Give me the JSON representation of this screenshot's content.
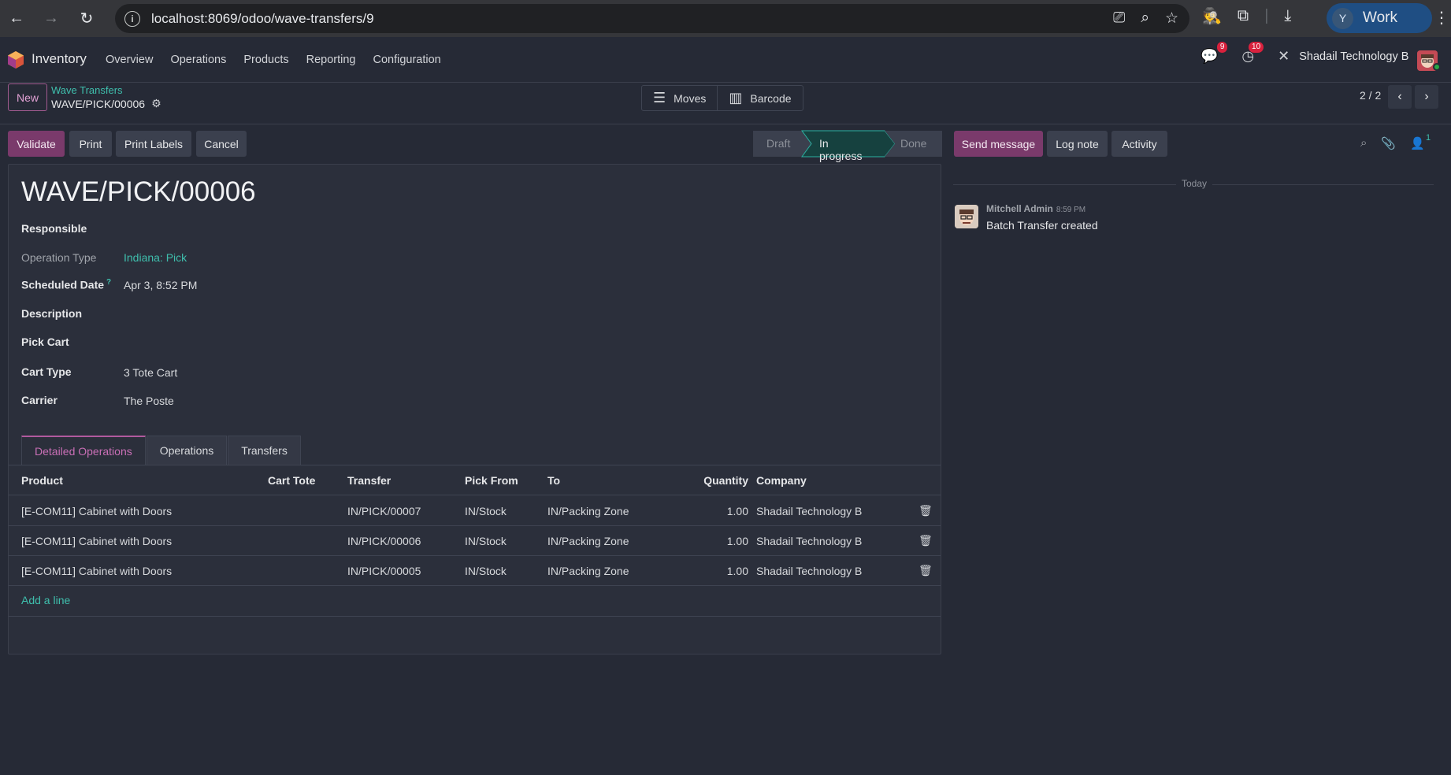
{
  "browser": {
    "url": "localhost:8069/odoo/wave-transfers/9",
    "profile_initial": "Y",
    "profile_label": "Work"
  },
  "navbar": {
    "app_name": "Inventory",
    "menu": [
      "Overview",
      "Operations",
      "Products",
      "Reporting",
      "Configuration"
    ],
    "messages_count": "9",
    "activities_count": "10",
    "company": "Shadail Technology B"
  },
  "control_panel": {
    "new_label": "New",
    "breadcrumb_parent": "Wave Transfers",
    "breadcrumb_current": "WAVE/PICK/00006",
    "smart_moves": "Moves",
    "smart_barcode": "Barcode",
    "pager": "2 / 2"
  },
  "actions": {
    "validate": "Validate",
    "print": "Print",
    "print_labels": "Print Labels",
    "cancel": "Cancel"
  },
  "status": {
    "steps": [
      "Draft",
      "In progress",
      "Done"
    ],
    "active": "In progress"
  },
  "form": {
    "title": "WAVE/PICK/00006",
    "responsible_label": "Responsible",
    "operation_type_label": "Operation Type",
    "operation_type_value": "Indiana: Pick",
    "scheduled_date_label": "Scheduled Date",
    "scheduled_date_help": "?",
    "scheduled_date_value": "Apr 3, 8:52 PM",
    "description_label": "Description",
    "pick_cart_label": "Pick Cart",
    "cart_type_label": "Cart Type",
    "cart_type_value": "3 Tote Cart",
    "carrier_label": "Carrier",
    "carrier_value": "The Poste"
  },
  "tabs": [
    "Detailed Operations",
    "Operations",
    "Transfers"
  ],
  "grid": {
    "headers": {
      "product": "Product",
      "tote": "Cart Tote",
      "transfer": "Transfer",
      "from": "Pick From",
      "to": "To",
      "qty": "Quantity",
      "company": "Company"
    },
    "rows": [
      {
        "product": "[E-COM11] Cabinet with Doors",
        "tote": "",
        "transfer": "IN/PICK/00007",
        "from": "IN/Stock",
        "to": "IN/Packing Zone",
        "qty": "1.00",
        "company": "Shadail Technology B"
      },
      {
        "product": "[E-COM11] Cabinet with Doors",
        "tote": "",
        "transfer": "IN/PICK/00006",
        "from": "IN/Stock",
        "to": "IN/Packing Zone",
        "qty": "1.00",
        "company": "Shadail Technology B"
      },
      {
        "product": "[E-COM11] Cabinet with Doors",
        "tote": "",
        "transfer": "IN/PICK/00005",
        "from": "IN/Stock",
        "to": "IN/Packing Zone",
        "qty": "1.00",
        "company": "Shadail Technology B"
      }
    ],
    "add_line": "Add a line"
  },
  "chatter": {
    "send_message": "Send message",
    "log_note": "Log note",
    "activity": "Activity",
    "followers_count": "1",
    "date_separator": "Today",
    "message_author": "Mitchell Admin",
    "message_time": "8:59 PM",
    "message_body": "Batch Transfer created"
  }
}
